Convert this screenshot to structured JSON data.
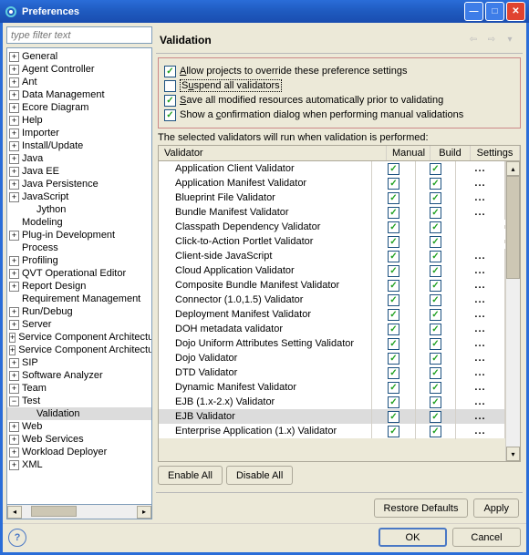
{
  "window": {
    "title": "Preferences"
  },
  "filter": {
    "placeholder": "type filter text"
  },
  "tree": [
    {
      "t": "p",
      "l": "General"
    },
    {
      "t": "p",
      "l": "Agent Controller"
    },
    {
      "t": "p",
      "l": "Ant"
    },
    {
      "t": "p",
      "l": "Data Management"
    },
    {
      "t": "p",
      "l": "Ecore Diagram"
    },
    {
      "t": "p",
      "l": "Help"
    },
    {
      "t": "p",
      "l": "Importer"
    },
    {
      "t": "p",
      "l": "Install/Update"
    },
    {
      "t": "p",
      "l": "Java"
    },
    {
      "t": "p",
      "l": "Java EE"
    },
    {
      "t": "p",
      "l": "Java Persistence"
    },
    {
      "t": "p",
      "l": "JavaScript"
    },
    {
      "t": "b",
      "l": "Jython",
      "indent": true
    },
    {
      "t": "b",
      "l": "Modeling"
    },
    {
      "t": "p",
      "l": "Plug-in Development"
    },
    {
      "t": "b",
      "l": "Process"
    },
    {
      "t": "p",
      "l": "Profiling"
    },
    {
      "t": "p",
      "l": "QVT Operational Editor"
    },
    {
      "t": "p",
      "l": "Report Design"
    },
    {
      "t": "b",
      "l": "Requirement Management"
    },
    {
      "t": "p",
      "l": "Run/Debug"
    },
    {
      "t": "p",
      "l": "Server"
    },
    {
      "t": "p",
      "l": "Service Component Architectu"
    },
    {
      "t": "p",
      "l": "Service Component Architectu"
    },
    {
      "t": "p",
      "l": "SIP"
    },
    {
      "t": "p",
      "l": "Software Analyzer"
    },
    {
      "t": "p",
      "l": "Team"
    },
    {
      "t": "m",
      "l": "Test"
    },
    {
      "t": "b",
      "l": "Validation",
      "sel": true,
      "indent": true
    },
    {
      "t": "p",
      "l": "Web"
    },
    {
      "t": "p",
      "l": "Web Services"
    },
    {
      "t": "p",
      "l": "Workload Deployer"
    },
    {
      "t": "p",
      "l": "XML"
    }
  ],
  "page": {
    "title": "Validation",
    "opt1": {
      "prefix": "",
      "u": "A",
      "rest": "llow projects to override these preference settings",
      "checked": true
    },
    "opt2": {
      "prefix": "S",
      "u": "u",
      "rest": "spend all validators",
      "checked": false
    },
    "opt3": {
      "prefix": "",
      "u": "S",
      "rest": "ave all modified resources automatically prior to validating",
      "checked": true
    },
    "opt4": {
      "prefix": "Show a ",
      "u": "c",
      "rest": "onfirmation dialog when performing manual validations",
      "checked": true
    },
    "tableLabel": "The selected validators will run when validation is performed:",
    "cols": {
      "validator": "Validator",
      "manual": "Manual",
      "build": "Build",
      "settings": "Settings"
    },
    "rows": [
      {
        "n": "Application Client Validator",
        "m": true,
        "b": true,
        "s": true
      },
      {
        "n": "Application Manifest Validator",
        "m": true,
        "b": true,
        "s": true
      },
      {
        "n": "Blueprint File Validator",
        "m": true,
        "b": true,
        "s": true
      },
      {
        "n": "Bundle Manifest Validator",
        "m": true,
        "b": true,
        "s": true
      },
      {
        "n": "Classpath Dependency Validator",
        "m": true,
        "b": true
      },
      {
        "n": "Click-to-Action Portlet Validator",
        "m": true,
        "b": true
      },
      {
        "n": "Client-side JavaScript",
        "m": true,
        "b": true,
        "s": true
      },
      {
        "n": "Cloud Application Validator",
        "m": true,
        "b": true,
        "s": true
      },
      {
        "n": "Composite Bundle Manifest Validator",
        "m": true,
        "b": true,
        "s": true
      },
      {
        "n": "Connector (1.0,1.5) Validator",
        "m": true,
        "b": true,
        "s": true
      },
      {
        "n": "Deployment Manifest Validator",
        "m": true,
        "b": true,
        "s": true
      },
      {
        "n": "DOH metadata validator",
        "m": true,
        "b": true,
        "s": true
      },
      {
        "n": "Dojo Uniform Attributes Setting Validator",
        "m": true,
        "b": true,
        "s": true
      },
      {
        "n": "Dojo Validator",
        "m": true,
        "b": true,
        "s": true
      },
      {
        "n": "DTD Validator",
        "m": true,
        "b": true,
        "s": true
      },
      {
        "n": "Dynamic Manifest Validator",
        "m": true,
        "b": true,
        "s": true
      },
      {
        "n": "EJB (1.x-2.x) Validator",
        "m": true,
        "b": true,
        "s": true
      },
      {
        "n": "EJB Validator",
        "m": true,
        "b": true,
        "s": true,
        "sel": true
      },
      {
        "n": "Enterprise Application (1.x) Validator",
        "m": true,
        "b": true,
        "s": true
      }
    ],
    "enableAll": "Enable All",
    "disableAll": "Disable All"
  },
  "footer": {
    "restore": "Restore Defaults",
    "apply": "Apply",
    "ok": "OK",
    "cancel": "Cancel"
  }
}
